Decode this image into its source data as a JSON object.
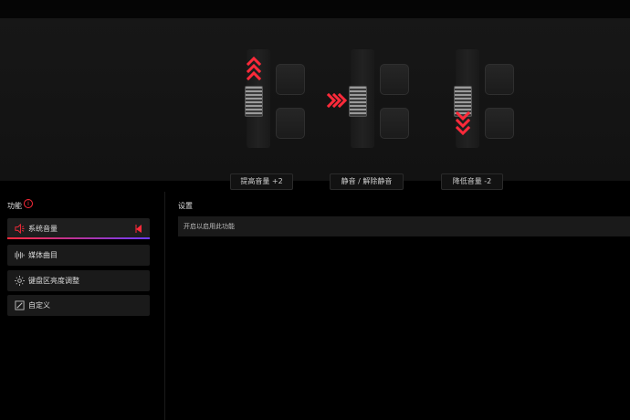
{
  "demos": [
    {
      "caption": "提高音量 +2",
      "direction": "up"
    },
    {
      "caption": "静音 / 解除静音",
      "direction": "press"
    },
    {
      "caption": "降低音量 -2",
      "direction": "down"
    }
  ],
  "sidebar": {
    "title": "功能",
    "info_icon": "info-icon",
    "items": [
      {
        "label": "系统音量",
        "icon": "volume-icon",
        "active": true
      },
      {
        "label": "媒体曲目",
        "icon": "media-track-icon",
        "active": false
      },
      {
        "label": "键盘区亮度调整",
        "icon": "brightness-icon",
        "active": false
      },
      {
        "label": "自定义",
        "icon": "edit-icon",
        "active": false
      }
    ]
  },
  "settings": {
    "title": "设置",
    "enable_text": "开启以启用此功能"
  },
  "colors": {
    "accent": "#ff2a3a",
    "accent2": "#6b3cff",
    "background": "#000000"
  }
}
